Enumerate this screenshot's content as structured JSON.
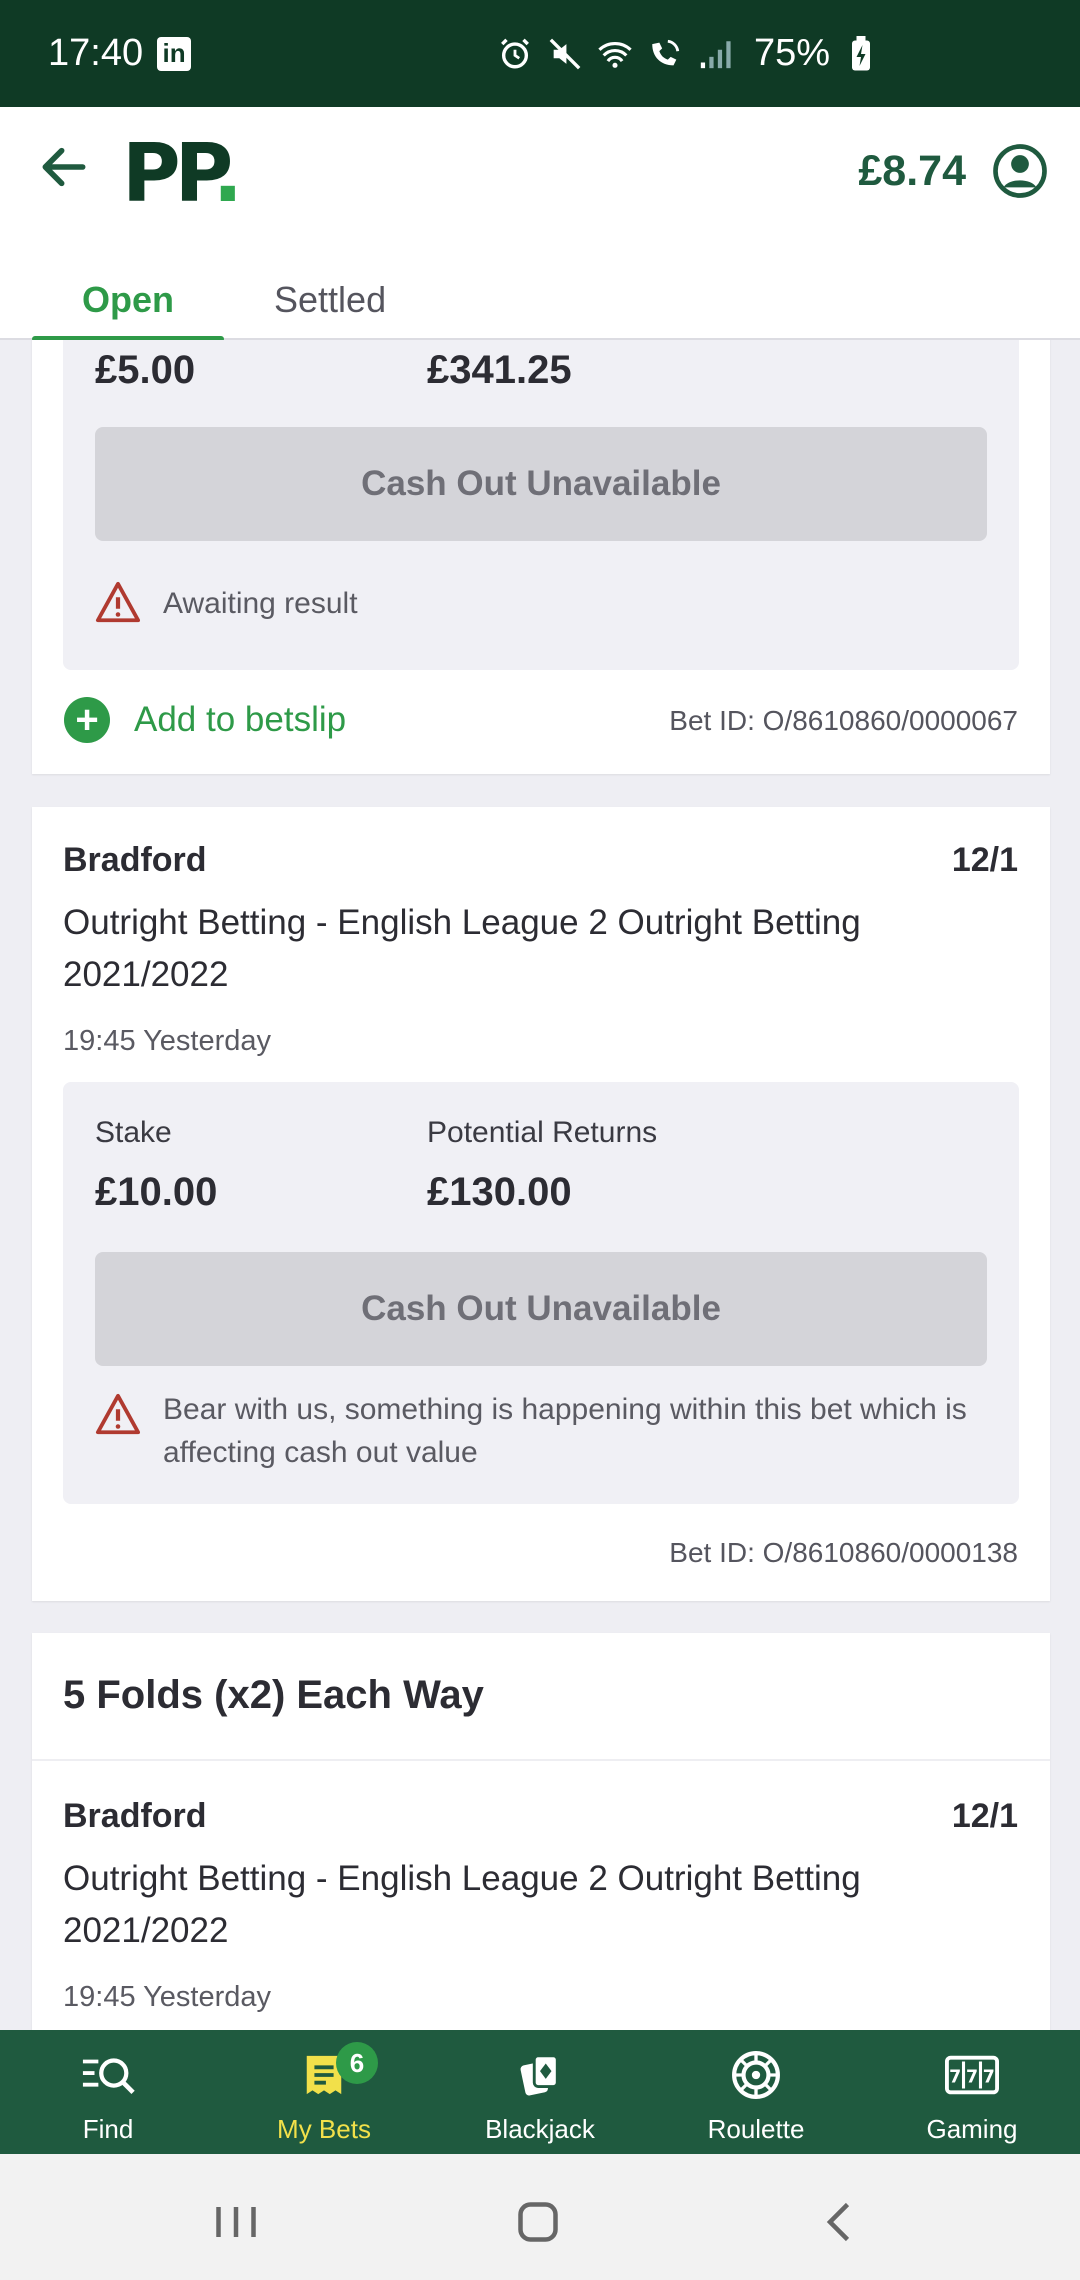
{
  "status_bar": {
    "time": "17:40",
    "battery": "75%",
    "icons": [
      "linkedin-icon",
      "alarm-icon",
      "mute-icon",
      "wifi-icon",
      "wifi-calling-icon",
      "signal-icon",
      "battery-charging-icon"
    ]
  },
  "header": {
    "logo": "PP",
    "logo_dot": ".",
    "balance": "£8.74"
  },
  "tabs": [
    {
      "label": "Open",
      "active": true
    },
    {
      "label": "Settled",
      "active": false
    }
  ],
  "bets": {
    "bet1": {
      "stake": "£5.00",
      "returns": "£341.25",
      "cashout_label": "Cash Out Unavailable",
      "status": "Awaiting result",
      "add_betslip": "Add to betslip",
      "bet_id": "Bet ID: O/8610860/0000067"
    },
    "bet2": {
      "selection": "Bradford",
      "odds": "12/1",
      "market": "Outright Betting - English League 2 Outright Betting 2021/2022",
      "time": "19:45 Yesterday",
      "stake_label": "Stake",
      "stake": "£10.00",
      "returns_label": "Potential Returns",
      "returns": "£130.00",
      "cashout_label": "Cash Out Unavailable",
      "warning": "Bear with us, something is happening within this bet which is affecting cash out value",
      "bet_id": "Bet ID: O/8610860/0000138"
    },
    "bet3": {
      "type": "5 Folds (x2) Each Way",
      "selection": "Bradford",
      "odds": "12/1",
      "market": "Outright Betting - English League 2 Outright Betting 2021/2022",
      "time": "19:45 Yesterday"
    }
  },
  "bottom_nav": [
    {
      "label": "Find",
      "icon": "find-icon"
    },
    {
      "label": "My Bets",
      "icon": "my-bets-icon",
      "badge": "6",
      "active": true
    },
    {
      "label": "Blackjack",
      "icon": "blackjack-icon"
    },
    {
      "label": "Roulette",
      "icon": "roulette-icon"
    },
    {
      "label": "Gaming",
      "icon": "slots-icon"
    }
  ],
  "colors": {
    "brand_dark": "#0f3a25",
    "brand_green": "#2e9a48",
    "nav_bg": "#1f5a3f",
    "active_nav": "#f2e04a",
    "warning_red": "#c0392b"
  }
}
